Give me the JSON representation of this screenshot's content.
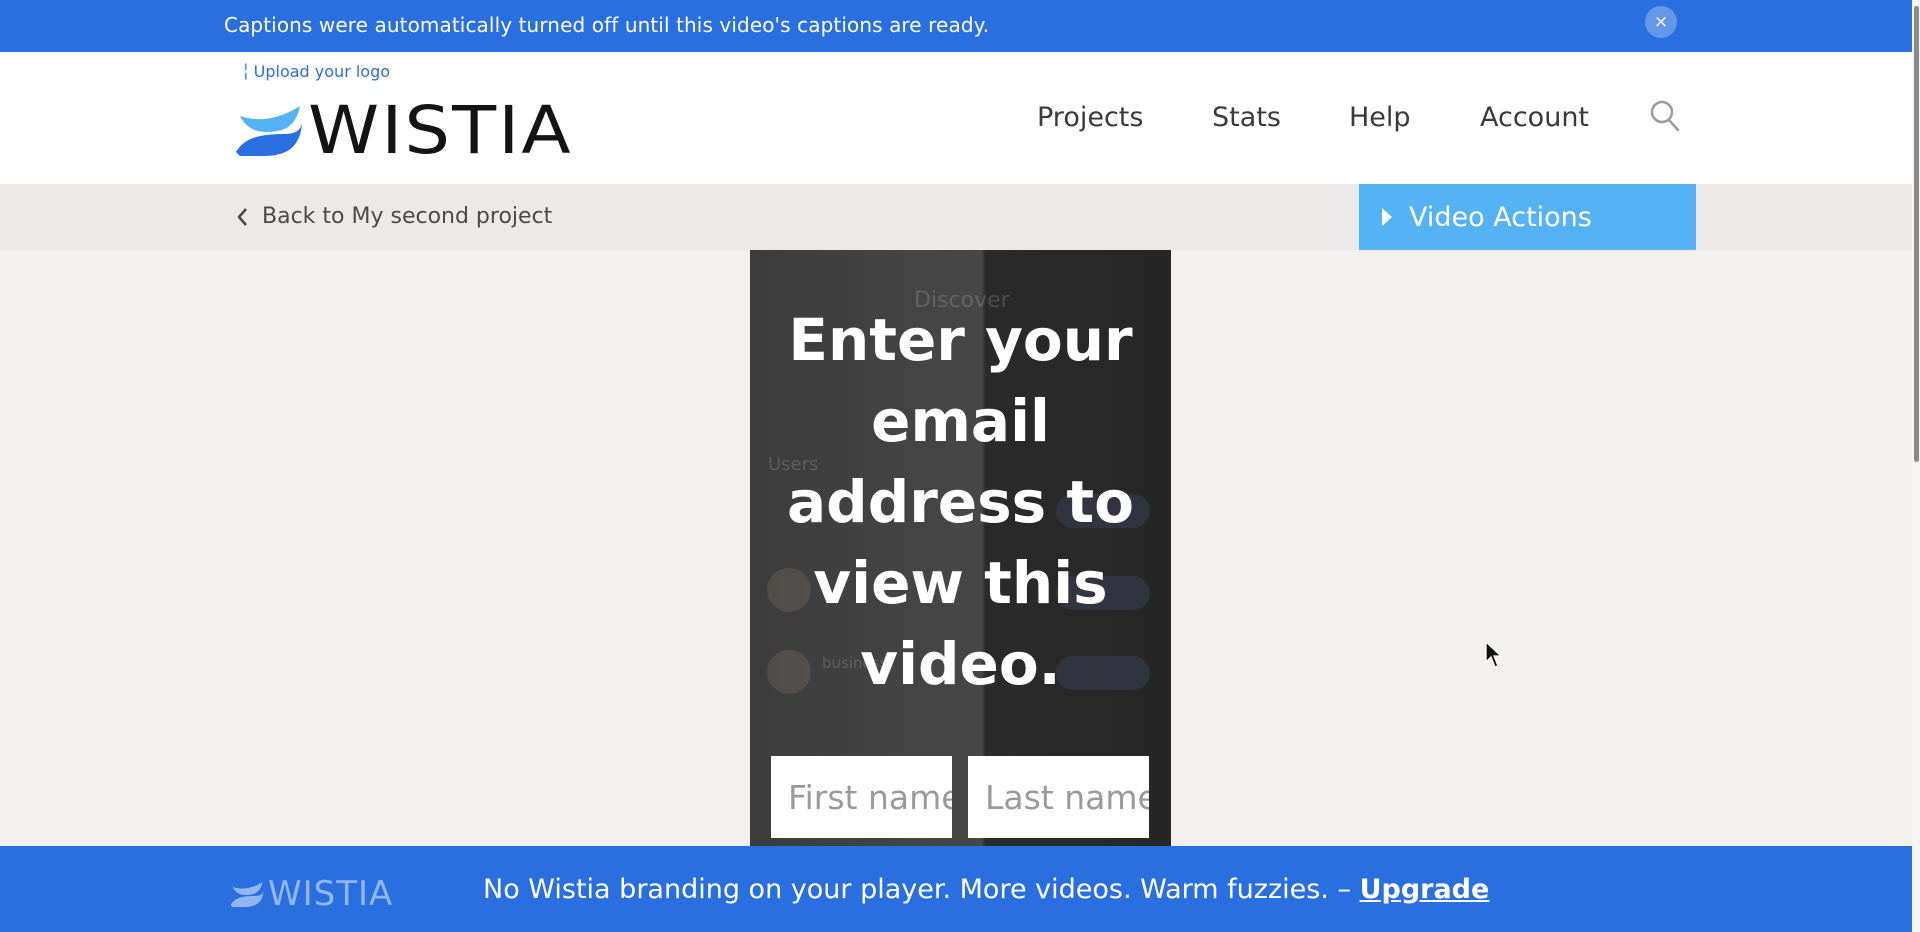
{
  "notice": {
    "text": "Captions were automatically turned off until this video's captions are ready.",
    "close_label": "×"
  },
  "header": {
    "upload_logo": "Upload your logo",
    "brand_name": "WISTIA",
    "nav": [
      "Projects",
      "Stats",
      "Help",
      "Account"
    ],
    "search_icon": "search-icon"
  },
  "subbar": {
    "back_label": "Back to My second project",
    "video_actions_label": "Video Actions"
  },
  "video": {
    "gate_title": "Enter your email address to view this video.",
    "first_name_placeholder": "First name",
    "last_name_placeholder": "Last name",
    "background_text": {
      "discover": "Discover",
      "users": "Users",
      "business": "business"
    }
  },
  "footer": {
    "brand_name": "WISTIA",
    "message": "No Wistia branding on your player. More videos. Warm fuzzies. –",
    "upgrade_label": "Upgrade"
  },
  "colors": {
    "brand_blue": "#2a6fe0",
    "video_actions_blue": "#54b2f5",
    "subbar_gray": "#ebeae8"
  }
}
